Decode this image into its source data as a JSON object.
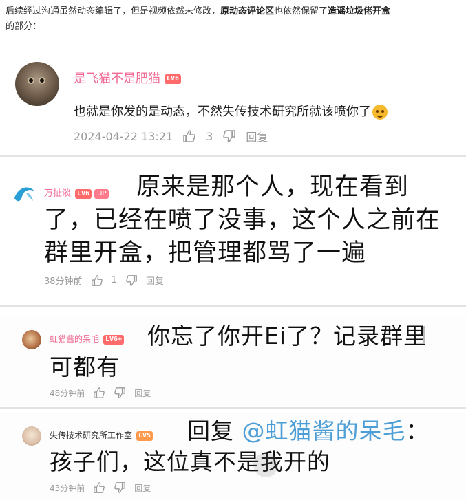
{
  "intro": {
    "part1": "后续经过沟通虽然动态编辑了，但是视频依然未修改，",
    "part2": "原动态评论区",
    "part3": "也依然保留了",
    "part4": "造谣垃圾佬开盒",
    "part5": "的部分："
  },
  "comments": [
    {
      "username": "是飞猫不是肥猫",
      "level": "LV6",
      "text": "也就是你发的是动态，不然失传技术研究所就该喷你了",
      "timestamp": "2024-04-22 13:21",
      "likes": "3",
      "reply_label": "回复"
    },
    {
      "username": "万扯淡",
      "level": "LV6",
      "badge": "UP",
      "text": "原来是那个人，现在看到了，已经在喷了没事，这个人之前在群里开盒，把管理都骂了一遍",
      "timestamp": "38分钟前",
      "likes": "1",
      "reply_label": "回复"
    },
    {
      "username": "虹猫酱的呆毛",
      "level": "LV6+",
      "text": "你忘了你开Ei了？记录群里可都有",
      "timestamp": "48分钟前",
      "reply_label": "回复"
    },
    {
      "username": "失传技术研究所工作室",
      "level": "LV5",
      "reply_prefix": "回复 ",
      "mention": "@虹猫酱的呆毛",
      "text": "：孩子们，这位真不是我开的",
      "timestamp": "43分钟前",
      "reply_label": "回复"
    }
  ],
  "icons": {
    "like": "thumbs-up-icon",
    "dislike": "thumbs-down-icon",
    "emoji": "grinning-sweat-emoji-icon"
  },
  "colors": {
    "username": "#f06a94",
    "mention": "#4d9ed6",
    "meta": "#9a9a9a",
    "level6": "#ff6b6b"
  }
}
